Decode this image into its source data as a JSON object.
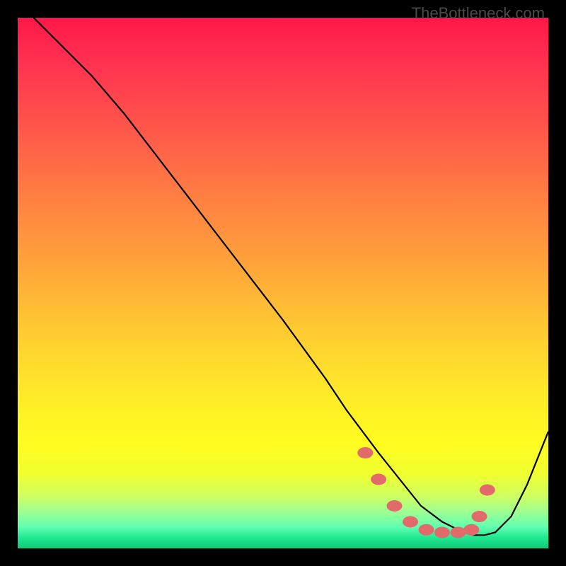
{
  "watermark": "TheBottleneck.com",
  "chart_data": {
    "type": "line",
    "title": "",
    "xlabel": "",
    "ylabel": "",
    "xlim": [
      0,
      100
    ],
    "ylim": [
      0,
      100
    ],
    "series": [
      {
        "name": "curve",
        "color": "#000000",
        "x": [
          3,
          6,
          10,
          14,
          20,
          30,
          40,
          50,
          58,
          62,
          65,
          68,
          72,
          76,
          80,
          84,
          86,
          88,
          90,
          93,
          96,
          100
        ],
        "y": [
          100,
          97,
          93,
          89,
          82,
          69,
          56,
          43,
          32,
          26,
          22,
          18,
          13,
          8,
          5,
          3,
          2.5,
          2.5,
          3,
          6,
          12,
          22
        ]
      }
    ],
    "markers": [
      {
        "name": "dots",
        "color": "#e26a6a",
        "x": [
          65.5,
          68,
          71,
          74,
          77,
          80,
          83,
          85.5,
          87,
          88.5
        ],
        "y": [
          18,
          13,
          8,
          5,
          3.5,
          3,
          3,
          3.5,
          6,
          11
        ]
      }
    ]
  }
}
